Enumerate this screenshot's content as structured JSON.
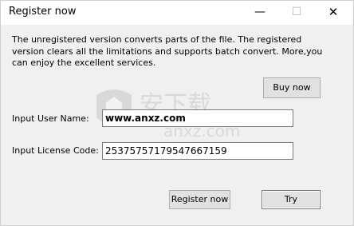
{
  "window": {
    "title": "Register now",
    "minimize_glyph": "—",
    "maximize_glyph": "☐",
    "close_glyph": "✕"
  },
  "message": "The unregistered version converts parts of the file. The registered version clears all the limitations and supports batch convert. More,you can enjoy the excellent services.",
  "buttons": {
    "buy_now": "Buy now",
    "register_now": "Register now",
    "try": "Try"
  },
  "fields": {
    "user_name_label": "Input User Name:",
    "user_name_value": "www.anxz.com",
    "license_label": "Input License Code:",
    "license_value": "253757571795476671​59"
  },
  "watermark": {
    "text": "安下载",
    "subtext": "anxz.com"
  }
}
